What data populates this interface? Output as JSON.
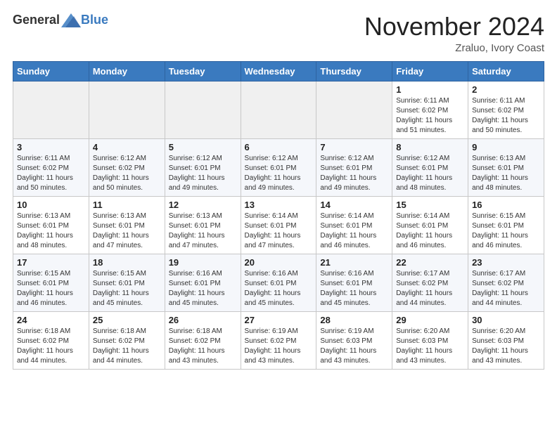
{
  "header": {
    "logo_general": "General",
    "logo_blue": "Blue",
    "month_title": "November 2024",
    "location": "Zraluo, Ivory Coast"
  },
  "weekdays": [
    "Sunday",
    "Monday",
    "Tuesday",
    "Wednesday",
    "Thursday",
    "Friday",
    "Saturday"
  ],
  "weeks": [
    [
      {
        "day": "",
        "info": ""
      },
      {
        "day": "",
        "info": ""
      },
      {
        "day": "",
        "info": ""
      },
      {
        "day": "",
        "info": ""
      },
      {
        "day": "",
        "info": ""
      },
      {
        "day": "1",
        "info": "Sunrise: 6:11 AM\nSunset: 6:02 PM\nDaylight: 11 hours\nand 51 minutes."
      },
      {
        "day": "2",
        "info": "Sunrise: 6:11 AM\nSunset: 6:02 PM\nDaylight: 11 hours\nand 50 minutes."
      }
    ],
    [
      {
        "day": "3",
        "info": "Sunrise: 6:11 AM\nSunset: 6:02 PM\nDaylight: 11 hours\nand 50 minutes."
      },
      {
        "day": "4",
        "info": "Sunrise: 6:12 AM\nSunset: 6:02 PM\nDaylight: 11 hours\nand 50 minutes."
      },
      {
        "day": "5",
        "info": "Sunrise: 6:12 AM\nSunset: 6:01 PM\nDaylight: 11 hours\nand 49 minutes."
      },
      {
        "day": "6",
        "info": "Sunrise: 6:12 AM\nSunset: 6:01 PM\nDaylight: 11 hours\nand 49 minutes."
      },
      {
        "day": "7",
        "info": "Sunrise: 6:12 AM\nSunset: 6:01 PM\nDaylight: 11 hours\nand 49 minutes."
      },
      {
        "day": "8",
        "info": "Sunrise: 6:12 AM\nSunset: 6:01 PM\nDaylight: 11 hours\nand 48 minutes."
      },
      {
        "day": "9",
        "info": "Sunrise: 6:13 AM\nSunset: 6:01 PM\nDaylight: 11 hours\nand 48 minutes."
      }
    ],
    [
      {
        "day": "10",
        "info": "Sunrise: 6:13 AM\nSunset: 6:01 PM\nDaylight: 11 hours\nand 48 minutes."
      },
      {
        "day": "11",
        "info": "Sunrise: 6:13 AM\nSunset: 6:01 PM\nDaylight: 11 hours\nand 47 minutes."
      },
      {
        "day": "12",
        "info": "Sunrise: 6:13 AM\nSunset: 6:01 PM\nDaylight: 11 hours\nand 47 minutes."
      },
      {
        "day": "13",
        "info": "Sunrise: 6:14 AM\nSunset: 6:01 PM\nDaylight: 11 hours\nand 47 minutes."
      },
      {
        "day": "14",
        "info": "Sunrise: 6:14 AM\nSunset: 6:01 PM\nDaylight: 11 hours\nand 46 minutes."
      },
      {
        "day": "15",
        "info": "Sunrise: 6:14 AM\nSunset: 6:01 PM\nDaylight: 11 hours\nand 46 minutes."
      },
      {
        "day": "16",
        "info": "Sunrise: 6:15 AM\nSunset: 6:01 PM\nDaylight: 11 hours\nand 46 minutes."
      }
    ],
    [
      {
        "day": "17",
        "info": "Sunrise: 6:15 AM\nSunset: 6:01 PM\nDaylight: 11 hours\nand 46 minutes."
      },
      {
        "day": "18",
        "info": "Sunrise: 6:15 AM\nSunset: 6:01 PM\nDaylight: 11 hours\nand 45 minutes."
      },
      {
        "day": "19",
        "info": "Sunrise: 6:16 AM\nSunset: 6:01 PM\nDaylight: 11 hours\nand 45 minutes."
      },
      {
        "day": "20",
        "info": "Sunrise: 6:16 AM\nSunset: 6:01 PM\nDaylight: 11 hours\nand 45 minutes."
      },
      {
        "day": "21",
        "info": "Sunrise: 6:16 AM\nSunset: 6:01 PM\nDaylight: 11 hours\nand 45 minutes."
      },
      {
        "day": "22",
        "info": "Sunrise: 6:17 AM\nSunset: 6:02 PM\nDaylight: 11 hours\nand 44 minutes."
      },
      {
        "day": "23",
        "info": "Sunrise: 6:17 AM\nSunset: 6:02 PM\nDaylight: 11 hours\nand 44 minutes."
      }
    ],
    [
      {
        "day": "24",
        "info": "Sunrise: 6:18 AM\nSunset: 6:02 PM\nDaylight: 11 hours\nand 44 minutes."
      },
      {
        "day": "25",
        "info": "Sunrise: 6:18 AM\nSunset: 6:02 PM\nDaylight: 11 hours\nand 44 minutes."
      },
      {
        "day": "26",
        "info": "Sunrise: 6:18 AM\nSunset: 6:02 PM\nDaylight: 11 hours\nand 43 minutes."
      },
      {
        "day": "27",
        "info": "Sunrise: 6:19 AM\nSunset: 6:02 PM\nDaylight: 11 hours\nand 43 minutes."
      },
      {
        "day": "28",
        "info": "Sunrise: 6:19 AM\nSunset: 6:03 PM\nDaylight: 11 hours\nand 43 minutes."
      },
      {
        "day": "29",
        "info": "Sunrise: 6:20 AM\nSunset: 6:03 PM\nDaylight: 11 hours\nand 43 minutes."
      },
      {
        "day": "30",
        "info": "Sunrise: 6:20 AM\nSunset: 6:03 PM\nDaylight: 11 hours\nand 43 minutes."
      }
    ]
  ]
}
